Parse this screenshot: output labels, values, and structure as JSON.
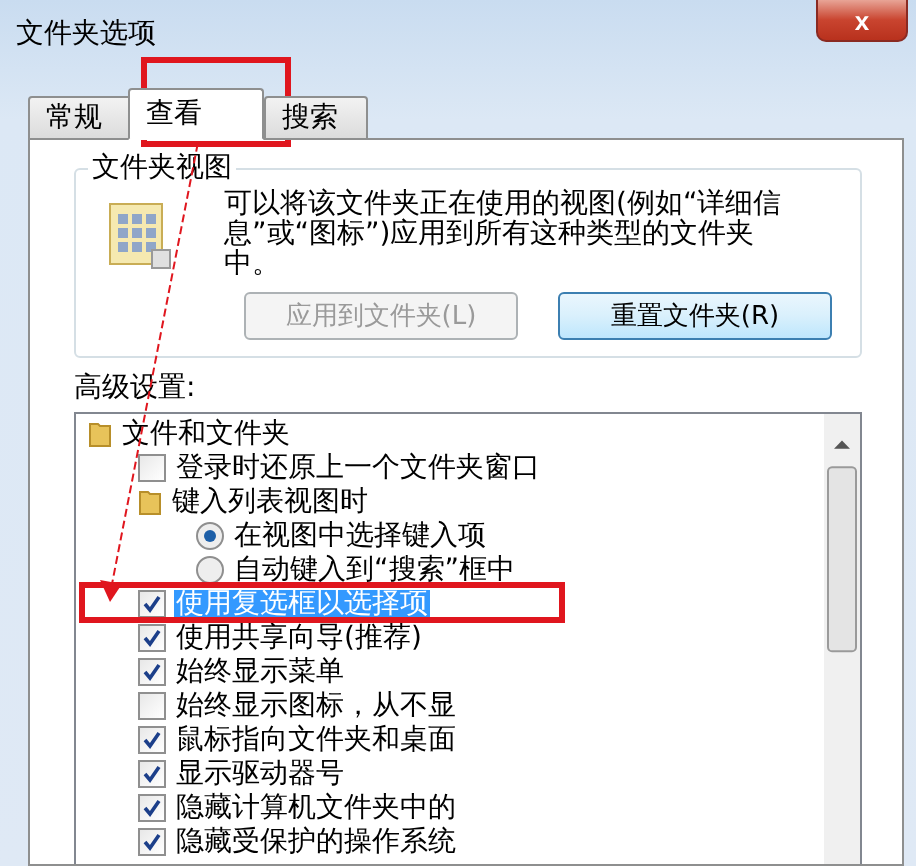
{
  "window": {
    "title": "文件夹选项",
    "close": "x"
  },
  "tabs": [
    {
      "label": "常规",
      "selected": false
    },
    {
      "label": "查看",
      "selected": true
    },
    {
      "label": "搜索",
      "selected": false
    }
  ],
  "folder_views": {
    "title": "文件夹视图",
    "description": "可以将该文件夹正在使用的视图(例如“详细信息”或“图标”)应用到所有这种类型的文件夹中。",
    "buttons": [
      {
        "label": "应用到文件夹(L)",
        "disabled": true
      },
      {
        "label": "重置文件夹(R)",
        "disabled": false
      }
    ]
  },
  "advanced": {
    "label": "高级设置:",
    "items": [
      {
        "kind": "folder",
        "label": "文件和文件夹",
        "selected": false,
        "children": [
          {
            "kind": "checkbox",
            "label": "登录时还原上一个文件夹窗口",
            "checked": false,
            "selected": false
          },
          {
            "kind": "folder",
            "label": "键入列表视图时",
            "selected": false,
            "children": [
              {
                "kind": "radio",
                "label": "在视图中选择键入项",
                "checked": true,
                "selected": false
              },
              {
                "kind": "radio",
                "label": "自动键入到“搜索”框中",
                "checked": false,
                "selected": false
              }
            ]
          },
          {
            "kind": "checkbox",
            "label": "使用复选框以选择项",
            "checked": true,
            "selected": true
          },
          {
            "kind": "checkbox",
            "label": "使用共享向导(推荐)",
            "checked": true,
            "selected": false
          },
          {
            "kind": "checkbox",
            "label": "始终显示菜单",
            "checked": true,
            "selected": false
          },
          {
            "kind": "checkbox",
            "label": "始终显示图标，从不显",
            "checked": false,
            "selected": false
          },
          {
            "kind": "checkbox",
            "label": "鼠标指向文件夹和桌面",
            "checked": true,
            "selected": false
          },
          {
            "kind": "checkbox",
            "label": "显示驱动器号",
            "checked": true,
            "selected": false
          },
          {
            "kind": "checkbox",
            "label": "隐藏计算机文件夹中的",
            "checked": true,
            "selected": false
          },
          {
            "kind": "checkbox",
            "label": "隐藏受保护的操作系统",
            "checked": true,
            "selected": false
          }
        ]
      }
    ]
  }
}
